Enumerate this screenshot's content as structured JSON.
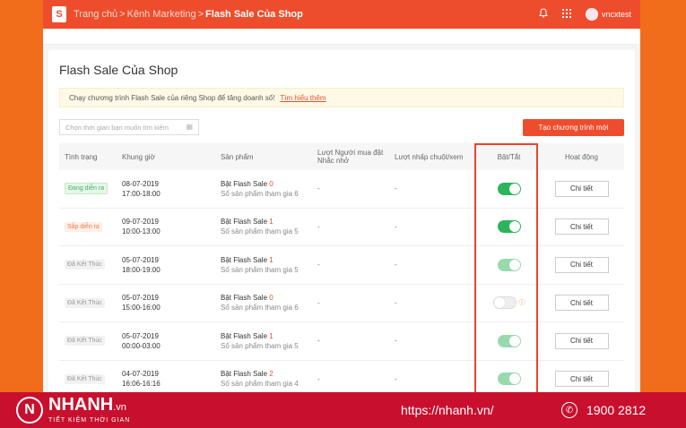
{
  "topbar": {
    "logo_letter": "S",
    "breadcrumb": [
      "Trang chủ",
      "Kênh Marketing",
      "Flash Sale Của Shop"
    ],
    "separator": ">",
    "bell_icon": "bell-icon",
    "apps_icon": "grid-icon",
    "username": "vncxtest"
  },
  "page": {
    "title": "Flash Sale Của Shop",
    "notice_text": "Chạy chương trình Flash Sale của riêng Shop để tăng doanh số!",
    "notice_link": "Tìm hiểu thêm",
    "search_placeholder": "Chọn thời gian bạn muốn tìm kiếm",
    "create_button": "Tạo chương trình mới"
  },
  "table": {
    "headers": {
      "status": "Tình trạng",
      "time": "Khung giờ",
      "product": "Sản phẩm",
      "reminder": "Lượt Người mua đặt Nhắc nhở",
      "clicks": "Lượt nhấp chuột/xem",
      "toggle": "Bật/Tắt",
      "action": "Hoạt động"
    },
    "rows": [
      {
        "status": "Đang diễn ra",
        "status_type": "ongoing",
        "date": "08-07-2019",
        "hours": "17:00-18:00",
        "product": "Bật Flash Sale",
        "count": "0",
        "sub": "Số sản phẩm tham gia 6",
        "reminder": "-",
        "clicks": "-",
        "toggle": "on",
        "action": "Chi tiết"
      },
      {
        "status": "Sắp diễn ra",
        "status_type": "upcoming",
        "date": "09-07-2019",
        "hours": "10:00-13:00",
        "product": "Bật Flash Sale",
        "count": "1",
        "sub": "Số sản phẩm tham gia 5",
        "reminder": "-",
        "clicks": "-",
        "toggle": "on",
        "action": "Chi tiết"
      },
      {
        "status": "Đã Kết Thúc",
        "status_type": "ended",
        "date": "05-07-2019",
        "hours": "18:00-19:00",
        "product": "Bật Flash Sale",
        "count": "1",
        "sub": "Số sản phẩm tham gia 5",
        "reminder": "-",
        "clicks": "-",
        "toggle": "on-light",
        "action": "Chi tiết"
      },
      {
        "status": "Đã Kết Thúc",
        "status_type": "ended",
        "date": "05-07-2019",
        "hours": "15:00-16:00",
        "product": "Bật Flash Sale",
        "count": "0",
        "sub": "Số sản phẩm tham gia 6",
        "reminder": "-",
        "clicks": "-",
        "toggle": "off",
        "action": "Chi tiết"
      },
      {
        "status": "Đã Kết Thúc",
        "status_type": "ended",
        "date": "05-07-2019",
        "hours": "00:00-03:00",
        "product": "Bật Flash Sale",
        "count": "1",
        "sub": "Số sản phẩm tham gia 5",
        "reminder": "-",
        "clicks": "-",
        "toggle": "on-light",
        "action": "Chi tiết"
      },
      {
        "status": "Đã Kết Thúc",
        "status_type": "ended",
        "date": "04-07-2019",
        "hours": "16:06-16:16",
        "product": "Bật Flash Sale",
        "count": "2",
        "sub": "Số sản phẩm tham gia 4",
        "reminder": "-",
        "clicks": "-",
        "toggle": "on-light",
        "action": "Chi tiết"
      }
    ]
  },
  "footer": {
    "brand_name": "NHANH",
    "brand_suffix": ".vn",
    "tagline": "TIẾT KIỆM THỜI GIAN",
    "url": "https://nhanh.vn/",
    "phone": "1900 2812"
  },
  "colors": {
    "brand_orange": "#ee4d2d",
    "background_orange": "#f26d1b",
    "footer_red": "#c8102e",
    "toggle_green": "#2db55d"
  }
}
